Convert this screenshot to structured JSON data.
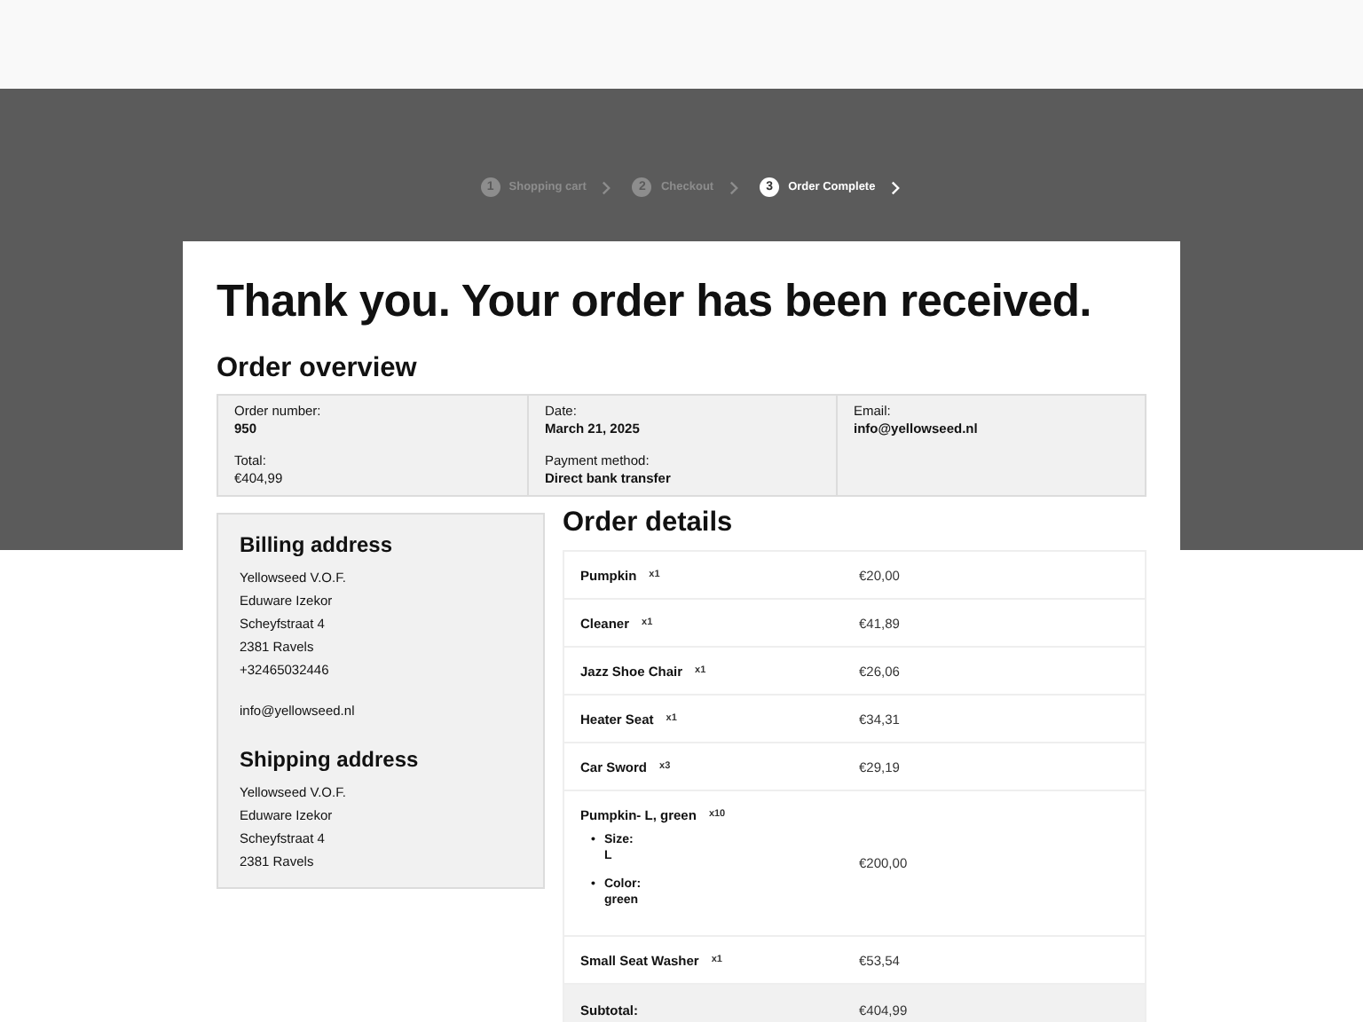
{
  "steps": [
    {
      "number": "1",
      "label": "Shopping cart",
      "selected": false
    },
    {
      "number": "2",
      "label": "Checkout",
      "selected": false
    },
    {
      "number": "3",
      "label": "Order Complete",
      "selected": true
    }
  ],
  "title": "Thank you. Your order has been received.",
  "overview": {
    "heading": "Order overview",
    "columns": [
      [
        {
          "label": "Order number:",
          "value": "950",
          "bold": true
        },
        {
          "label": "Total:",
          "value": "€404,99",
          "bold": false
        }
      ],
      [
        {
          "label": "Date:",
          "value": "March 21, 2025",
          "bold": true
        },
        {
          "label": "Payment method:",
          "value": "Direct bank transfer",
          "bold": true
        }
      ],
      [
        {
          "label": "Email:",
          "value": "info@yellowseed.nl",
          "bold": true
        }
      ]
    ]
  },
  "billing": {
    "heading": "Billing address",
    "lines": [
      "Yellowseed V.O.F.",
      "Eduware Izekor",
      "Scheyfstraat 4",
      "2381 Ravels",
      "+32465032446"
    ],
    "email": "info@yellowseed.nl"
  },
  "shipping": {
    "heading": "Shipping address",
    "lines": [
      "Yellowseed V.O.F.",
      "Eduware Izekor",
      "Scheyfstraat 4",
      "2381 Ravels"
    ]
  },
  "order_details": {
    "heading": "Order details",
    "rows": [
      {
        "kind": "item",
        "product": "Pumpkin",
        "qty": "x1",
        "price": "€20,00"
      },
      {
        "kind": "item",
        "product": "Cleaner",
        "qty": "x1",
        "price": "€41,89"
      },
      {
        "kind": "item",
        "product": "Jazz Shoe Chair",
        "qty": "x1",
        "price": "€26,06"
      },
      {
        "kind": "item",
        "product": "Heater Seat",
        "qty": "x1",
        "price": "€34,31"
      },
      {
        "kind": "item",
        "product": "Car Sword",
        "qty": "x3",
        "price": "€29,19"
      },
      {
        "kind": "item",
        "product": "Pumpkin- L, green",
        "qty": "x10",
        "price": "€200,00",
        "meta": [
          {
            "marker": "•",
            "label": "Size:",
            "value": "L"
          },
          {
            "marker": "•",
            "label": "Color:",
            "value": "green"
          }
        ]
      },
      {
        "kind": "item",
        "product": "Small Seat Washer",
        "qty": "x1",
        "price": "€53,54"
      },
      {
        "kind": "total",
        "label": "Subtotal:",
        "price": "€404,99"
      }
    ]
  }
}
